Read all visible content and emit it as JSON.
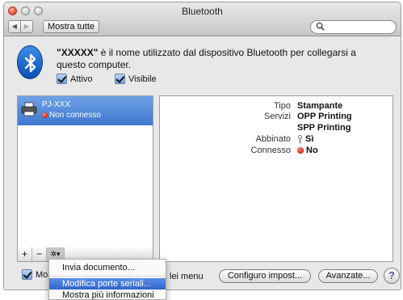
{
  "window": {
    "title": "Bluetooth"
  },
  "toolbar": {
    "show_all": "Mostra tutte",
    "search_placeholder": ""
  },
  "intro": {
    "name_quoted": "\"XXXXX\"",
    "text": " è il nome utilizzato dal dispositivo Bluetooth per collegarsi a questo computer."
  },
  "options": {
    "active": "Attivo",
    "visible": "Visibile"
  },
  "devices": [
    {
      "name": "PJ-XXX",
      "status": "Non connesso"
    }
  ],
  "details": {
    "type_label": "Tipo",
    "type_value": "Stampante",
    "services_label": "Servizi",
    "services_value_1": "OPP Printing",
    "services_value_2": "SPP Printing",
    "paired_label": "Abbinato",
    "paired_value": "Sì",
    "connected_label": "Connesso",
    "connected_value": "No"
  },
  "list_buttons": {
    "add": "+",
    "remove": "−",
    "gear": "✲▾"
  },
  "bottom": {
    "show_menu_prefix": "Most",
    "show_menu_suffix": "lei menu",
    "configure": "Configuro impost...",
    "advanced": "Avanzate...",
    "help": "?"
  },
  "menu": {
    "items": [
      "Invia documento...",
      "Modifica porte seriali...",
      "Mostra più informazioni"
    ],
    "selected_index": 1
  }
}
